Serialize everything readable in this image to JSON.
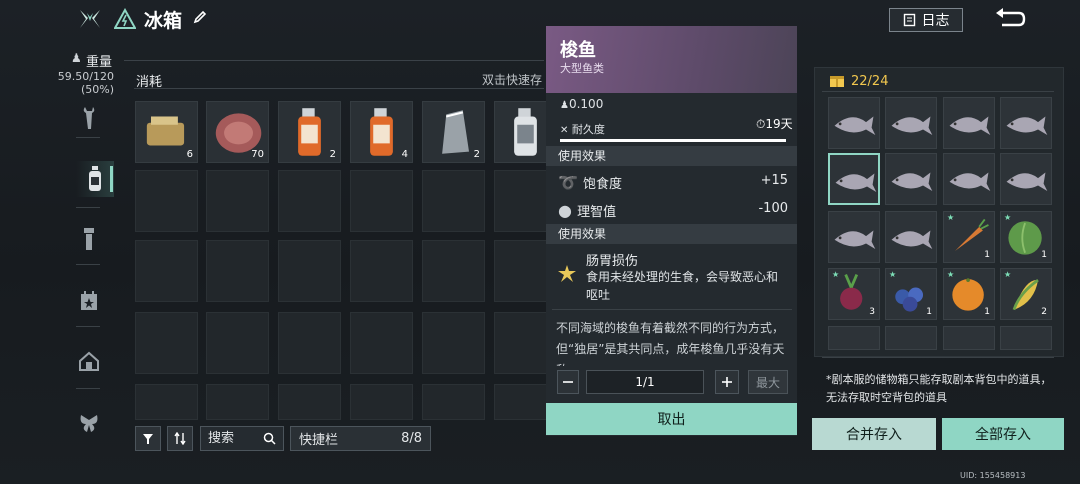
{
  "header": {
    "title": "冰箱",
    "log_label": "日志"
  },
  "weight": {
    "label": "重量",
    "value": "59.50/120",
    "percent": "(50%)"
  },
  "inventory": {
    "category": "消耗",
    "hint": "双击快速存",
    "items": [
      {
        "name": "canned-food",
        "count": "6"
      },
      {
        "name": "raw-meat",
        "count": "70"
      },
      {
        "name": "orange-spray-bottle",
        "count": "2"
      },
      {
        "name": "orange-spray-bottle",
        "count": "4"
      },
      {
        "name": "sealed-bag",
        "count": "2"
      },
      {
        "name": "white-spray-bottle",
        "count": ""
      }
    ],
    "search_label": "搜索",
    "quickbar_label": "快捷栏",
    "quickbar_count": "8/8"
  },
  "detail": {
    "name": "梭鱼",
    "subtitle": "大型鱼类",
    "weight": "0.100",
    "durability_label": "耐久度",
    "days": "19天",
    "durability": 1.0,
    "section1": "使用效果",
    "effects": [
      {
        "label": "饱食度",
        "value": "+15"
      },
      {
        "label": "理智值",
        "value": "-100"
      }
    ],
    "section2": "使用效果",
    "status_title": "肠胃损伤",
    "status_desc": "食用未经处理的生食，会导致恶心和呕吐",
    "description": "不同海域的梭鱼有着截然不同的行为方式，但“独居”是其共同点，成年梭鱼几乎没有天敌",
    "quantity": "1/1",
    "max_label": "最大",
    "take_label": "取出"
  },
  "storage": {
    "count": "22/24",
    "slots": [
      {
        "item": "fish",
        "count": ""
      },
      {
        "item": "fish",
        "count": ""
      },
      {
        "item": "fish",
        "count": ""
      },
      {
        "item": "fish",
        "count": ""
      },
      {
        "item": "fish",
        "count": ""
      },
      {
        "item": "fish",
        "count": ""
      },
      {
        "item": "fish",
        "count": ""
      },
      {
        "item": "fish",
        "count": ""
      },
      {
        "item": "fish",
        "count": ""
      },
      {
        "item": "fish",
        "count": ""
      },
      {
        "item": "carrot",
        "count": "1"
      },
      {
        "item": "cabbage",
        "count": "1"
      },
      {
        "item": "beet",
        "count": "3"
      },
      {
        "item": "blueberries",
        "count": "1"
      },
      {
        "item": "orange",
        "count": "1"
      },
      {
        "item": "corn",
        "count": "2"
      }
    ],
    "note": "*剧本服的储物箱只能存取剧本背包中的道具，无法存取时空背包的道具",
    "merge_label": "合并存入",
    "all_label": "全部存入"
  },
  "uid": "UID: 155458913",
  "colors": {
    "accent": "#8fd6c4",
    "rarity_purple": "#7a5a84",
    "gold": "#f2c84f"
  }
}
